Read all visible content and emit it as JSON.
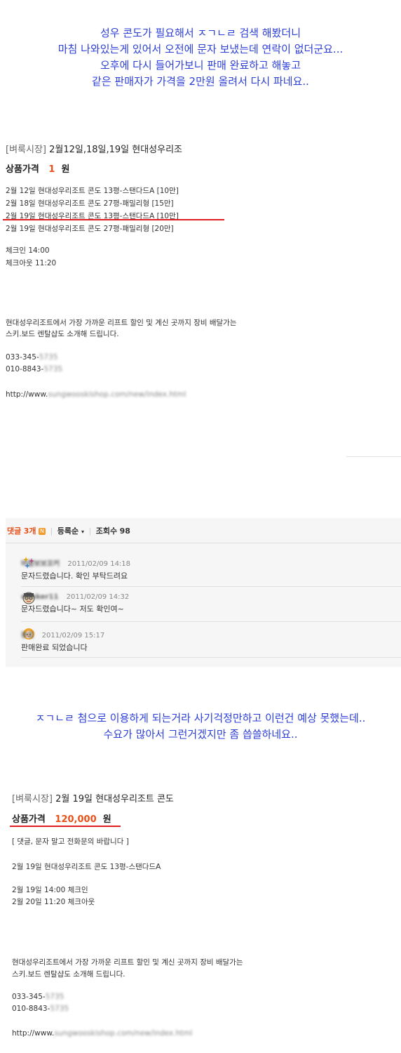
{
  "intro": {
    "lines": [
      "성우 콘도가 필요해서 ㅈㄱㄴㄹ 검색 해봤더니",
      "마침 나와있는게 있어서 오전에 문자 보냈는데 연락이 없더군요...",
      "오후에 다시 들어가보니 판매 완료하고 해놓고",
      "같은 판매자가 가격을 2만원 올려서 다시 파네요.."
    ]
  },
  "post1": {
    "category": "[벼룩시장]",
    "title": "2월12일,18일,19일 현대성우리조",
    "price_label": "상품가격",
    "price_value": "1",
    "price_unit": "원",
    "items": [
      "2월 12일  현대성우리조트 콘도  13평-스탠다드A [10만]",
      "2월 18일  현대성우리조트 콘도  27평-패밀리형 [15만]",
      "2월 19일  현대성우리조트 콘도  13평-스탠다드A [10만]",
      "2월 19일  현대성우리조트 콘도  27평-패밀리형 [20만]"
    ],
    "checkin": "체크인  14:00",
    "checkout": "체크아웃  11:20",
    "desc1": "현대성우리조트에서 가장 가까운 리프트  할인 및 계신 곳까지 장비 배달가는",
    "desc2": "스키.보드 렌탈샵도 소개해 드립니다.",
    "phone1_prefix": "033-345-",
    "phone1_blur": "5735",
    "phone2_prefix": "010-8843-",
    "phone2_blur": "5735",
    "url_prefix": "http://www.",
    "url_blur": "sungwooskishop.com/new/index.html"
  },
  "comments": {
    "label": "댓글",
    "count": "3개",
    "new_badge": "N",
    "sort": "등록순",
    "views_label": "조회수",
    "views": "98",
    "items": [
      {
        "nick": "바람보보꼬커",
        "date": "2011/02/09 14:18",
        "text": "문자드렸습니다. 확인 부탁드려요"
      },
      {
        "nick": "dunker11",
        "date": "2011/02/09 14:32",
        "text": "문자드렸습니다~ 저도 확인여~"
      },
      {
        "nick": "봉접",
        "date": "2011/02/09 15:17",
        "text": "판매완료 되었습니다"
      }
    ]
  },
  "middle": {
    "lines": [
      "ㅈㄱㄴㄹ 첨으로 이용하게 되는거라 사기걱정만하고 이런건 예상 못했는데..",
      "수요가 많아서 그런거겠지만 좀 씁쓸하네요.."
    ]
  },
  "post2": {
    "category": "[벼룩시장]",
    "title": "2월 19일 현대성우리조트 콘도",
    "price_label": "상품가격",
    "price_value": "120,000",
    "price_unit": "원",
    "note": "[ 댓글, 문자 말고    전화문의 바랍니다 ]",
    "item": "2월 19일  현대성우리조트 콘도  13평-스탠다드A",
    "checkin": "2월 19일   14:00    체크인",
    "checkout": "2월 20일  11:20     체크아웃",
    "desc1": "현대성우리조트에서 가장 가까운 리프트  할인 및 계신 곳까지 장비 배달가는",
    "desc2": "스키.보드 렌탈샵도 소개해 드립니다.",
    "phone1_prefix": "033-345-",
    "phone1_blur": "5735",
    "phone2_prefix": "010-8843-",
    "phone2_blur": "5735",
    "url_prefix": "http://www.",
    "url_blur": "sungwooskishop.com/new/index.html"
  },
  "colors": {
    "intro_text": "#2b3ed8",
    "price": "#e8501a",
    "underline": "#e02020"
  }
}
